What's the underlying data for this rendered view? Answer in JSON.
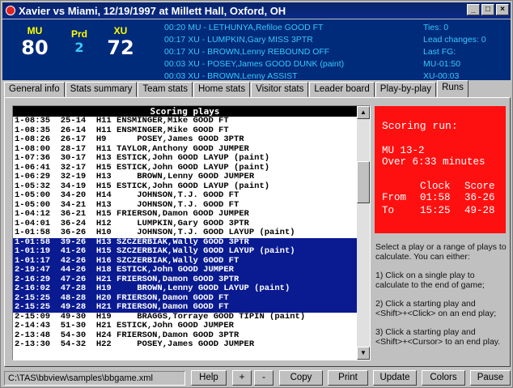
{
  "window": {
    "title": "Xavier vs Miami, 12/19/1997 at Millett Hall, Oxford, OH",
    "min": "_",
    "max": "□",
    "close": "×"
  },
  "scoreboard": {
    "home_abbr": "MU",
    "home_score": "80",
    "prd_label": "Prd",
    "prd_value": "2",
    "away_abbr": "XU",
    "away_score": "72",
    "log": [
      "00:20 MU - LETHUNYA,Refiloe GOOD FT",
      "00:17 XU - LUMPKIN,Gary MISS 3PTR",
      "00:17 XU - BROWN,Lenny REBOUND OFF",
      "00:03 XU - POSEY,James GOOD DUNK (paint)",
      "00:03 XU - BROWN,Lenny ASSIST"
    ],
    "stats": [
      "Ties: 0",
      "Lead changes: 0",
      "Last FG:",
      "MU-01:50",
      "XU-00:03"
    ]
  },
  "tabs": [
    "General info",
    "Stats summary",
    "Team stats",
    "Home stats",
    "Visitor stats",
    "Leader board",
    "Play-by-play",
    "Runs"
  ],
  "list": {
    "header": "Scoring plays",
    "rows": [
      "1-08:35  25-14  H11 ENSMINGER,Mike GOOD FT",
      "1-08:35  26-14  H11 ENSMINGER,Mike GOOD FT",
      "1-08:26  26-17  H9      POSEY,James GOOD 3PTR",
      "1-08:00  28-17  H11 TAYLOR,Anthony GOOD JUMPER",
      "1-07:36  30-17  H13 ESTICK,John GOOD LAYUP (paint)",
      "1-06:41  32-17  H15 ESTICK,John GOOD LAYUP (paint)",
      "1-06:29  32-19  H13     BROWN,Lenny GOOD JUMPER",
      "1-05:32  34-19  H15 ESTICK,John GOOD LAYUP (paint)",
      "1-05:00  34-20  H14     JOHNSON,T.J. GOOD FT",
      "1-05:00  34-21  H13     JOHNSON,T.J. GOOD FT",
      "1-04:12  36-21  H15 FRIERSON,Damon GOOD JUMPER",
      "1-04:01  36-24  H12     LUMPKIN,Gary GOOD 3PTR",
      "1-01:58  36-26  H10     JOHNSON,T.J. GOOD LAYUP (paint)",
      "1-01:58  39-26  H13 SZCZERBIAK,Wally GOOD 3PTR",
      "1-01:19  41-26  H15 SZCZERBIAK,Wally GOOD LAYUP (paint)",
      "1-01:17  42-26  H16 SZCZERBIAK,Wally GOOD FT",
      "2-19:47  44-26  H18 ESTICK,John GOOD JUMPER",
      "2-16:29  47-26  H21 FRIERSON,Damon GOOD 3PTR",
      "2-16:02  47-28  H19     BROWN,Lenny GOOD LAYUP (paint)",
      "2-15:25  48-28  H20 FRIERSON,Damon GOOD FT",
      "2-15:25  49-28  H21 FRIERSON,Damon GOOD FT",
      "2-15:09  49-30  H19     BRAGGS,Torraye GOOD TIPIN (paint)",
      "2-14:43  51-30  H21 ESTICK,John GOOD JUMPER",
      "2-13:48  54-30  H24 FRIERSON,Damon GOOD 3PTR",
      "2-13:30  54-32  H22     POSEY,James GOOD JUMPER"
    ]
  },
  "run": {
    "title": "Scoring run:",
    "line1": "MU 13-2",
    "line2": "Over 6:33 minutes",
    "clock_hdr": "Clock",
    "score_hdr": "Score",
    "from_label": "From",
    "from_clock": "01:58",
    "from_score": "36-26",
    "to_label": "To",
    "to_clock": "15:25",
    "to_score": "49-28"
  },
  "help": [
    "Select a play or a range of plays to calculate.  You can either:",
    "1) Click on a single play to calculate to the end of game;",
    "2) Click a starting play and <Shift>+<Click> on an end play;",
    "3) Click a starting play and <Shift>+<Cursor> to an end play."
  ],
  "status": {
    "path": "C:\\TAS\\bbview\\samples\\bbgame.xml",
    "buttons": [
      "Help",
      "+",
      "-",
      "Copy",
      "Print",
      "Update",
      "Colors",
      "Pause"
    ]
  }
}
